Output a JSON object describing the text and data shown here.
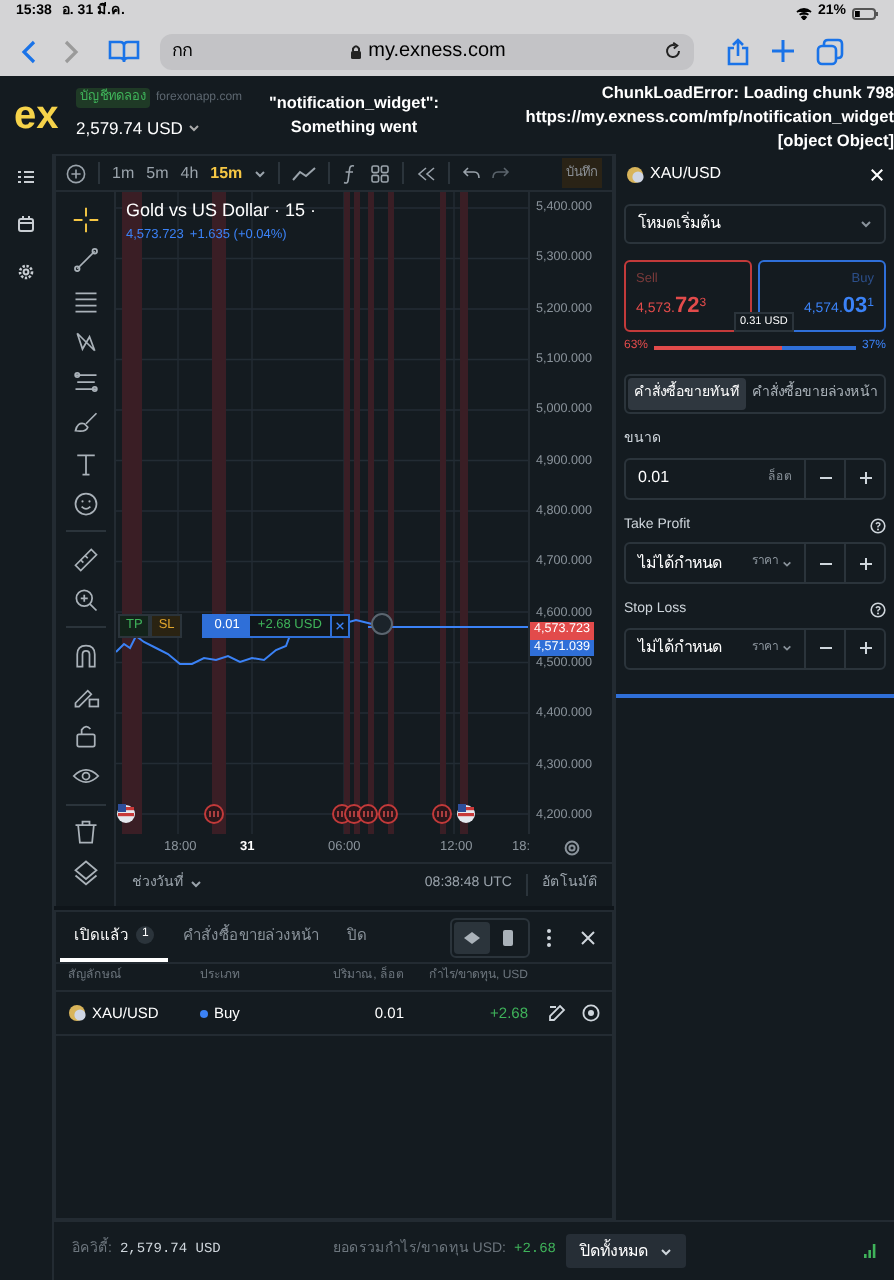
{
  "browser": {
    "time": "15:38",
    "date": "อ. 31 มี.ค.",
    "battery": "21%",
    "text_size": "กก",
    "url": "my.exness.com"
  },
  "header": {
    "logo": "ex",
    "account_badge": "บัญชีทดลอง",
    "site": "forexonapp.com",
    "balance": "2,579.74 USD",
    "error_center": [
      "\"notification_widget\":",
      "Something went"
    ],
    "error_right": [
      "ChunkLoadError: Loading chunk 798",
      "https://my.exness.com/mfp/notification_widget",
      "[object Object]"
    ]
  },
  "chart_toolbar": {
    "timeframes": [
      {
        "label": "1m",
        "selected": false
      },
      {
        "label": "5m",
        "selected": false
      },
      {
        "label": "4h",
        "selected": false
      },
      {
        "label": "15m",
        "selected": true
      }
    ],
    "save_label": "บันทึก"
  },
  "chart": {
    "title": "Gold vs US Dollar · 15 ·",
    "price": "4,573.723",
    "change": "+1.635 (+0.04%)",
    "price_labels": [
      "5,400.000",
      "5,300.000",
      "5,200.000",
      "5,100.000",
      "5,000.000",
      "4,900.000",
      "4,800.000",
      "4,700.000",
      "4,600.000",
      "4,500.000",
      "4,400.000",
      "4,300.000",
      "4,200.000"
    ],
    "bid_tag": "4,573.723",
    "ask_tag": "4,571.039",
    "time_labels": [
      {
        "label": "18:00",
        "bold": false
      },
      {
        "label": "31",
        "bold": true
      },
      {
        "label": "06:00",
        "bold": false
      },
      {
        "label": "12:00",
        "bold": false
      },
      {
        "label": "18:",
        "bold": false
      }
    ],
    "position": {
      "tp": "TP",
      "sl": "SL",
      "volume": "0.01",
      "profit": "+2.68 USD"
    },
    "range_label": "ช่วงวันที่",
    "clock": "08:38:48 UTC",
    "auto_label": "อัตโนมัติ"
  },
  "positions_panel": {
    "tabs": [
      {
        "label": "เปิดแล้ว",
        "count": "1",
        "selected": true
      },
      {
        "label": "คำสั่งซื้อขายล่วงหน้า",
        "selected": false
      },
      {
        "label": "ปิด",
        "selected": false
      }
    ],
    "view_modes": [
      {
        "selected": true
      },
      {
        "selected": false
      }
    ],
    "columns": [
      "สัญลักษณ์",
      "ประเภท",
      "ปริมาณ, ล็อต",
      "กำไร/ขาดทุน, USD"
    ],
    "rows": [
      {
        "symbol": "XAU/USD",
        "side": "Buy",
        "volume": "0.01",
        "profit": "+2.68"
      }
    ]
  },
  "order_panel": {
    "symbol": "XAU/USD",
    "mode": "โหมดเริ่มต้น",
    "sell": {
      "label": "Sell",
      "price": "4,573.**72**$^{3}$"
    },
    "buy": {
      "label": "Buy",
      "price": "4,574.**03**$^{1}$"
    },
    "spread": "0.31 USD",
    "sentiment": {
      "sell_pct": "63%",
      "buy_pct": "37%",
      "level": 0.63
    },
    "order_types": [
      {
        "label": "คำสั่งซื้อขายทันที",
        "selected": true
      },
      {
        "label": "คำสั่งซื้อขายล่วงหน้า",
        "selected": false
      }
    ],
    "volume": {
      "label": "ขนาด",
      "value": "0.01",
      "unit": "ล็อต"
    },
    "take_profit": {
      "label": "Take Profit",
      "value": "ไม่ได้กำหนด",
      "unit": "ราคา"
    },
    "stop_loss": {
      "label": "Stop Loss",
      "value": "ไม่ได้กำหนด",
      "unit": "ราคา"
    }
  },
  "footer": {
    "equity_label": "อิควิตี้:",
    "equity": "2,579.74 USD",
    "total_label": "ยอดรวมกำไร/ขาดทุน USD:",
    "total": "+2.68",
    "close_all": "ปิดทั้งหมด"
  }
}
